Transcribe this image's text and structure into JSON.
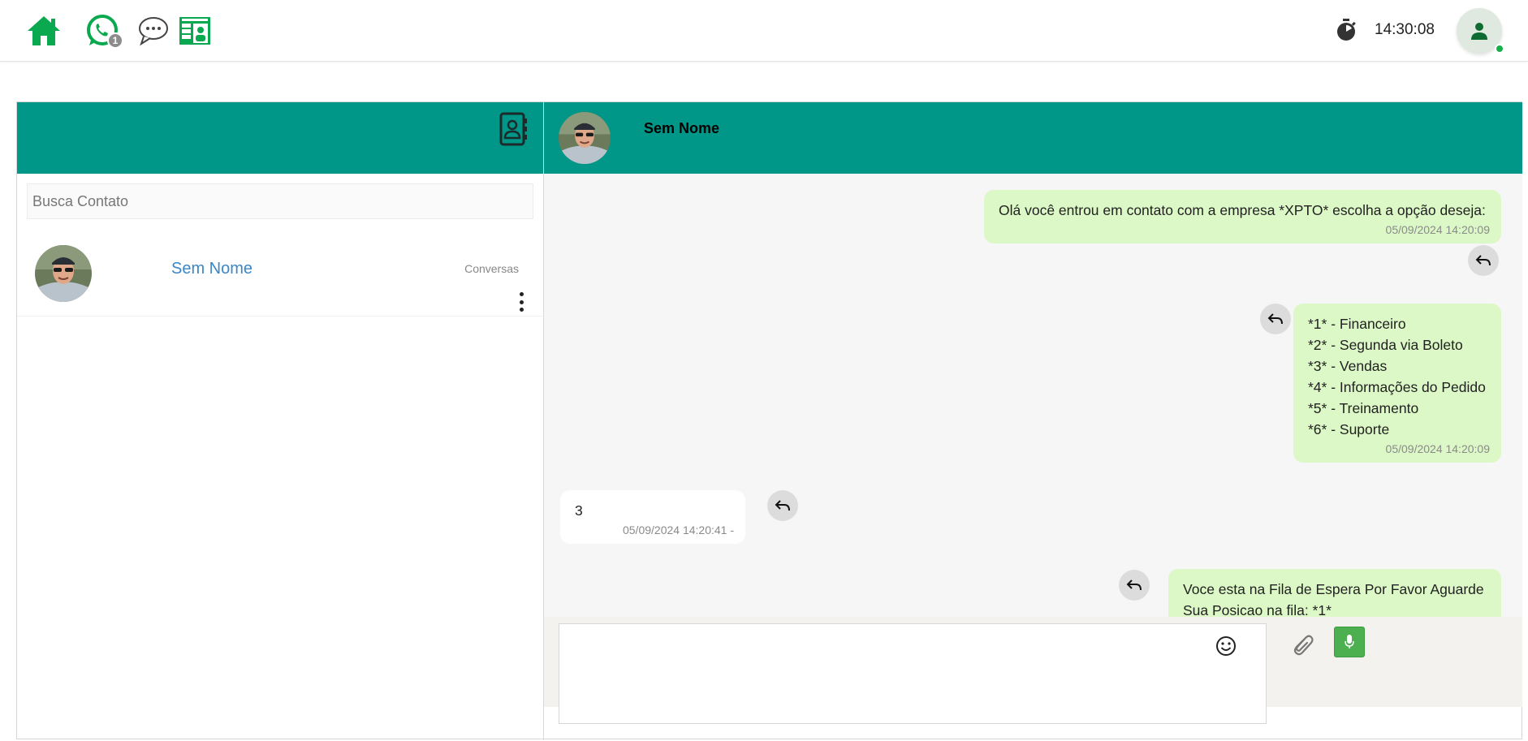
{
  "topbar": {
    "nav_icons": [
      "home-icon",
      "whatsapp-icon",
      "chat-bubble-icon",
      "contact-card-icon"
    ],
    "whatsapp_badge": "1",
    "clock": "14:30:08"
  },
  "colors": {
    "brand_green": "#0aa84f",
    "header_teal": "#009688",
    "out_bubble": "#dcf8c6",
    "mic_button": "#4caf50"
  },
  "sidebar": {
    "search_placeholder": "Busca Contato",
    "contacts": [
      {
        "name": "Sem Nome",
        "tag": "Conversas"
      }
    ]
  },
  "chat": {
    "contact_name": "Sem Nome",
    "messages": [
      {
        "direction": "out",
        "lines": [
          "Olá você entrou em contato com a empresa *XPTO* escolha a opção deseja:"
        ],
        "time": "05/09/2024 14:20:09"
      },
      {
        "direction": "out",
        "lines": [
          "*1* - Financeiro",
          "*2* - Segunda via Boleto",
          "*3* - Vendas",
          "*4* - Informações do Pedido",
          "*5* - Treinamento",
          "*6* - Suporte"
        ],
        "time": "05/09/2024 14:20:09"
      },
      {
        "direction": "in",
        "lines": [
          "3"
        ],
        "time": "05/09/2024 14:20:41 -"
      },
      {
        "direction": "out",
        "lines": [
          "Voce esta na Fila de Espera Por Favor Aguarde",
          "Sua Posicao na fila: *1*"
        ],
        "time": ""
      }
    ]
  },
  "composer": {
    "placeholder": ""
  }
}
